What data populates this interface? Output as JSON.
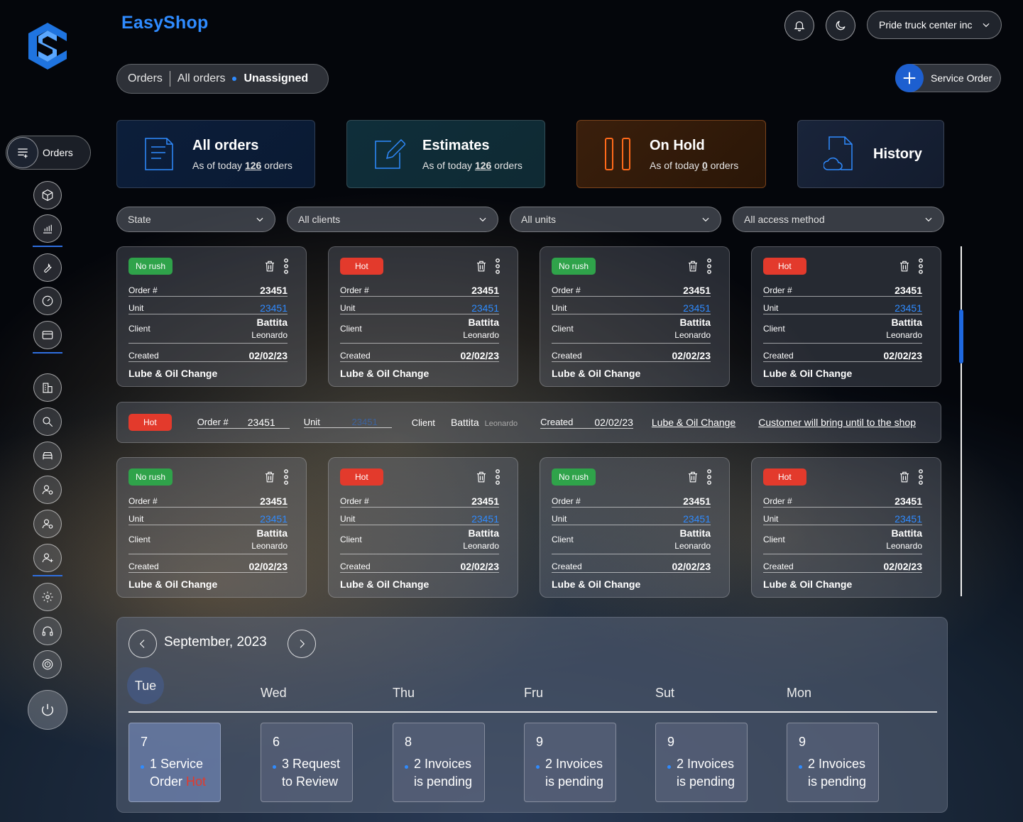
{
  "brand": "EasyShop",
  "header": {
    "company": "Pride truck center inc",
    "service_order_label": "Service Order"
  },
  "breadcrumb": [
    "Orders",
    "All orders",
    "Unassigned"
  ],
  "sidebar": {
    "orders_label": "Orders"
  },
  "stats": [
    {
      "title": "All orders",
      "prefix": "As of today ",
      "count": "126",
      "suffix": " orders"
    },
    {
      "title": "Estimates",
      "prefix": "As of today ",
      "count": "126",
      "suffix": " orders"
    },
    {
      "title": "On Hold",
      "prefix": "As of today ",
      "count": "0",
      "suffix": " orders"
    },
    {
      "title": "History"
    }
  ],
  "filters": [
    "State",
    "All clients",
    "All units",
    "All access method"
  ],
  "labels": {
    "order": "Order #",
    "unit": "Unit",
    "client": "Client",
    "created": "Created"
  },
  "cards": [
    {
      "tag": "No rush",
      "order": "23451",
      "unit": "23451",
      "client_first": "Battita",
      "client_last": "Leonardo",
      "created": "02/02/23",
      "service": "Lube & Oil Change"
    },
    {
      "tag": "Hot",
      "order": "23451",
      "unit": "23451",
      "client_first": "Battita",
      "client_last": "Leonardo",
      "created": "02/02/23",
      "service": "Lube & Oil Change"
    },
    {
      "tag": "No rush",
      "order": "23451",
      "unit": "23451",
      "client_first": "Battita",
      "client_last": "Leonardo",
      "created": "02/02/23",
      "service": "Lube & Oil Change"
    },
    {
      "tag": "Hot",
      "order": "23451",
      "unit": "23451",
      "client_first": "Battita",
      "client_last": "Leonardo",
      "created": "02/02/23",
      "service": "Lube & Oil Change"
    },
    {
      "tag": "No rush",
      "order": "23451",
      "unit": "23451",
      "client_first": "Battita",
      "client_last": "Leonardo",
      "created": "02/02/23",
      "service": "Lube & Oil Change"
    },
    {
      "tag": "Hot",
      "order": "23451",
      "unit": "23451",
      "client_first": "Battita",
      "client_last": "Leonardo",
      "created": "02/02/23",
      "service": "Lube & Oil Change"
    },
    {
      "tag": "No rush",
      "order": "23451",
      "unit": "23451",
      "client_first": "Battita",
      "client_last": "Leonardo",
      "created": "02/02/23",
      "service": "Lube & Oil Change"
    },
    {
      "tag": "Hot",
      "order": "23451",
      "unit": "23451",
      "client_first": "Battita",
      "client_last": "Leonardo",
      "created": "02/02/23",
      "service": "Lube & Oil Change"
    }
  ],
  "wide_row": {
    "tag": "Hot",
    "order": "23451",
    "unit": "23451",
    "client_first": "Battita",
    "client_last": "Leonardo",
    "created": "02/02/23",
    "service": "Lube & Oil Change",
    "note": "Customer will bring until to the shop"
  },
  "calendar": {
    "month": "September, 2023",
    "days": [
      {
        "label": "Tue",
        "num": "7",
        "line1": "1 Service",
        "line2": "Order",
        "hot": "Hot"
      },
      {
        "label": "Wed",
        "num": "6",
        "line1": "3 Request",
        "line2": "to Review"
      },
      {
        "label": "Thu",
        "num": "8",
        "line1": "2 Invoices",
        "line2": "is pending"
      },
      {
        "label": "Fru",
        "num": "9",
        "line1": "2 Invoices",
        "line2": "is pending"
      },
      {
        "label": "Sut",
        "num": "9",
        "line1": "2 Invoices",
        "line2": "is pending"
      },
      {
        "label": "Mon",
        "num": "9",
        "line1": "2 Invoices",
        "line2": "is pending"
      }
    ]
  },
  "colors": {
    "accent": "#2f8bff",
    "hot": "#e33a2c",
    "no_rush": "#2fa34a",
    "hold": "#ff8a3c"
  }
}
